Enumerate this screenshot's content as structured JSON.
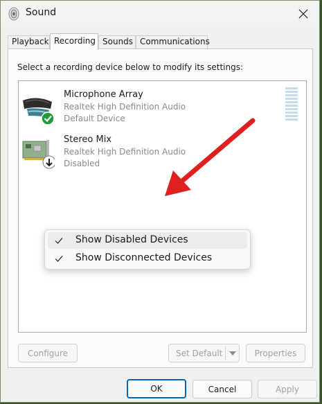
{
  "window": {
    "title": "Sound",
    "close_icon": "close-icon",
    "app_icon": "speaker-icon"
  },
  "tabs": [
    {
      "label": "Playback",
      "active": false
    },
    {
      "label": "Recording",
      "active": true
    },
    {
      "label": "Sounds",
      "active": false
    },
    {
      "label": "Communications",
      "active": false
    }
  ],
  "panel": {
    "instruction": "Select a recording device below to modify its settings:"
  },
  "devices": [
    {
      "name": "Microphone Array",
      "driver": "Realtek High Definition Audio",
      "status": "Default Device",
      "icon": "microphone-array-icon",
      "badge": "default-check-icon",
      "badge_color": "#1e9b3a"
    },
    {
      "name": "Stereo Mix",
      "driver": "Realtek High Definition Audio",
      "status": "Disabled",
      "icon": "sound-card-icon",
      "badge": "disabled-arrow-icon"
    }
  ],
  "context_menu": {
    "items": [
      {
        "label": "Show Disabled Devices",
        "checked": true
      },
      {
        "label": "Show Disconnected Devices",
        "checked": true
      }
    ]
  },
  "annotation": {
    "arrow_color": "#e02020"
  },
  "buttons": {
    "configure": "Configure",
    "set_default": "Set Default",
    "properties": "Properties",
    "ok": "OK",
    "cancel": "Cancel",
    "apply": "Apply"
  },
  "colors": {
    "accent": "#0067c0",
    "desktop": "#3b5423"
  }
}
